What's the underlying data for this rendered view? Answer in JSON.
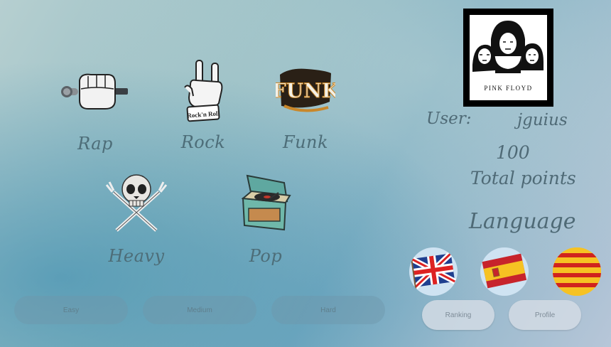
{
  "genres": {
    "rap": "Rap",
    "rock": "Rock",
    "funk": "Funk",
    "heavy": "Heavy",
    "pop": "Pop",
    "rock_badge": "Rock'n Roll",
    "funk_badge": "FUNK"
  },
  "difficulty": {
    "easy": "Easy",
    "medium": "Medium",
    "hard": "Hard"
  },
  "profile": {
    "avatar_caption": "PINK FLOYD",
    "user_label": "User:",
    "username": "jguius",
    "points_value": "100",
    "points_label": "Total points",
    "language_label": "Language"
  },
  "actions": {
    "ranking": "Ranking",
    "profile": "Profile"
  },
  "colors": {
    "label_text": "#4d6d78",
    "difficulty_button": "#6e96aa",
    "side_button": "#d2dae4"
  },
  "flags": [
    "united-kingdom-flag",
    "spain-flag",
    "catalonia-flag"
  ]
}
